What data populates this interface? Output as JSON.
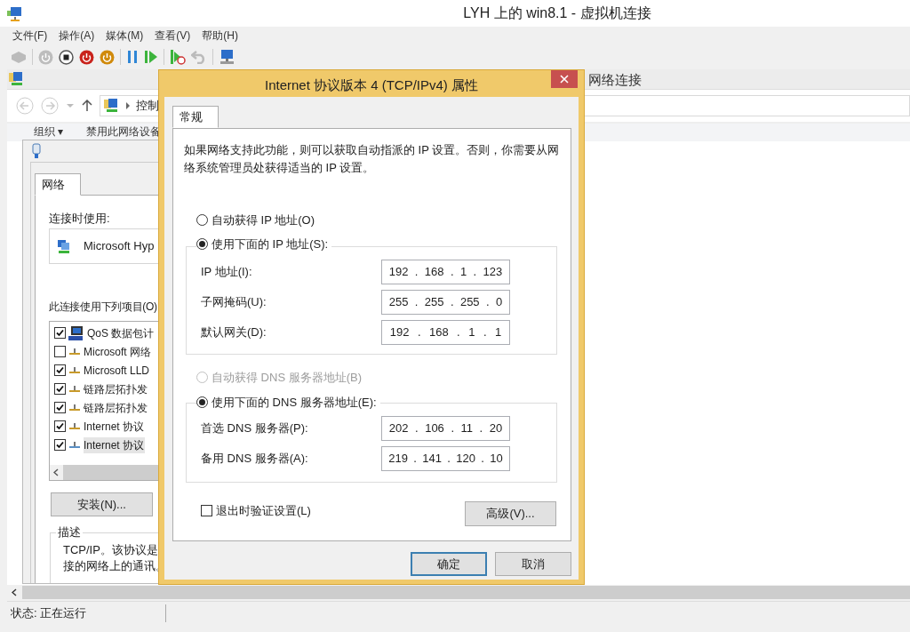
{
  "window": {
    "title": "LYH 上的 win8.1 - 虚拟机连接"
  },
  "menu": [
    {
      "label": "文件(F)"
    },
    {
      "label": "操作(A)"
    },
    {
      "label": "媒体(M)"
    },
    {
      "label": "查看(V)"
    },
    {
      "label": "帮助(H)"
    }
  ],
  "explorer": {
    "title": "网络连接",
    "address": "控制",
    "commands": [
      "组织 ▾",
      "禁用此网络设备"
    ]
  },
  "adapter_dialog": {
    "tabs": [
      {
        "label": "网络",
        "selected": true
      }
    ],
    "connect_using_label": "连接时使用:",
    "adapter": "Microsoft Hyp",
    "items_label": "此连接使用下列项目(O)",
    "items": [
      {
        "label": "QoS 数据包计",
        "checked": true,
        "selected": false,
        "kind": "scheduler"
      },
      {
        "label": "Microsoft 网络",
        "checked": false,
        "selected": false,
        "kind": "protocol"
      },
      {
        "label": "Microsoft LLD",
        "checked": true,
        "selected": false,
        "kind": "protocol"
      },
      {
        "label": "链路层拓扑发",
        "checked": true,
        "selected": false,
        "kind": "protocol"
      },
      {
        "label": "链路层拓扑发",
        "checked": true,
        "selected": false,
        "kind": "protocol"
      },
      {
        "label": "Internet 协议",
        "checked": true,
        "selected": false,
        "kind": "protocol"
      },
      {
        "label": "Internet 协议",
        "checked": true,
        "selected": true,
        "kind": "protocol"
      }
    ],
    "install_button": "安装(N)...",
    "description_title": "描述",
    "description_lines": [
      "TCP/IP。该协议是",
      "接的网络上的通讯。"
    ]
  },
  "ipv4_dialog": {
    "title": "Internet 协议版本 4 (TCP/IPv4) 属性",
    "tabs": [
      {
        "label": "常规",
        "selected": true
      }
    ],
    "intro": "如果网络支持此功能，则可以获取自动指派的 IP 设置。否则，你需要从网络系统管理员处获得适当的 IP 设置。",
    "separator": ".",
    "ip_modes": [
      {
        "label": "自动获得 IP 地址(O)",
        "selected": false,
        "disabled": false
      },
      {
        "label": "使用下面的 IP 地址(S):",
        "selected": true,
        "disabled": false
      }
    ],
    "ip_fields": [
      {
        "label": "IP 地址(I):",
        "octets": [
          "192",
          "168",
          "1",
          "123"
        ]
      },
      {
        "label": "子网掩码(U):",
        "octets": [
          "255",
          "255",
          "255",
          "0"
        ]
      },
      {
        "label": "默认网关(D):",
        "octets": [
          "192",
          "168",
          "1",
          "1"
        ]
      }
    ],
    "dns_modes": [
      {
        "label": "自动获得 DNS 服务器地址(B)",
        "selected": false,
        "disabled": true
      },
      {
        "label": "使用下面的 DNS 服务器地址(E):",
        "selected": true,
        "disabled": false
      }
    ],
    "dns_fields": [
      {
        "label": "首选 DNS 服务器(P):",
        "octets": [
          "202",
          "106",
          "11",
          "20"
        ]
      },
      {
        "label": "备用 DNS 服务器(A):",
        "octets": [
          "219",
          "141",
          "120",
          "10"
        ]
      }
    ],
    "validate": {
      "label": "退出时验证设置(L)",
      "checked": false
    },
    "advanced_button": "高级(V)...",
    "buttons": [
      {
        "label": "确定",
        "default": true
      },
      {
        "label": "取消",
        "default": false
      }
    ]
  },
  "status_bar": "状态: 正在运行"
}
